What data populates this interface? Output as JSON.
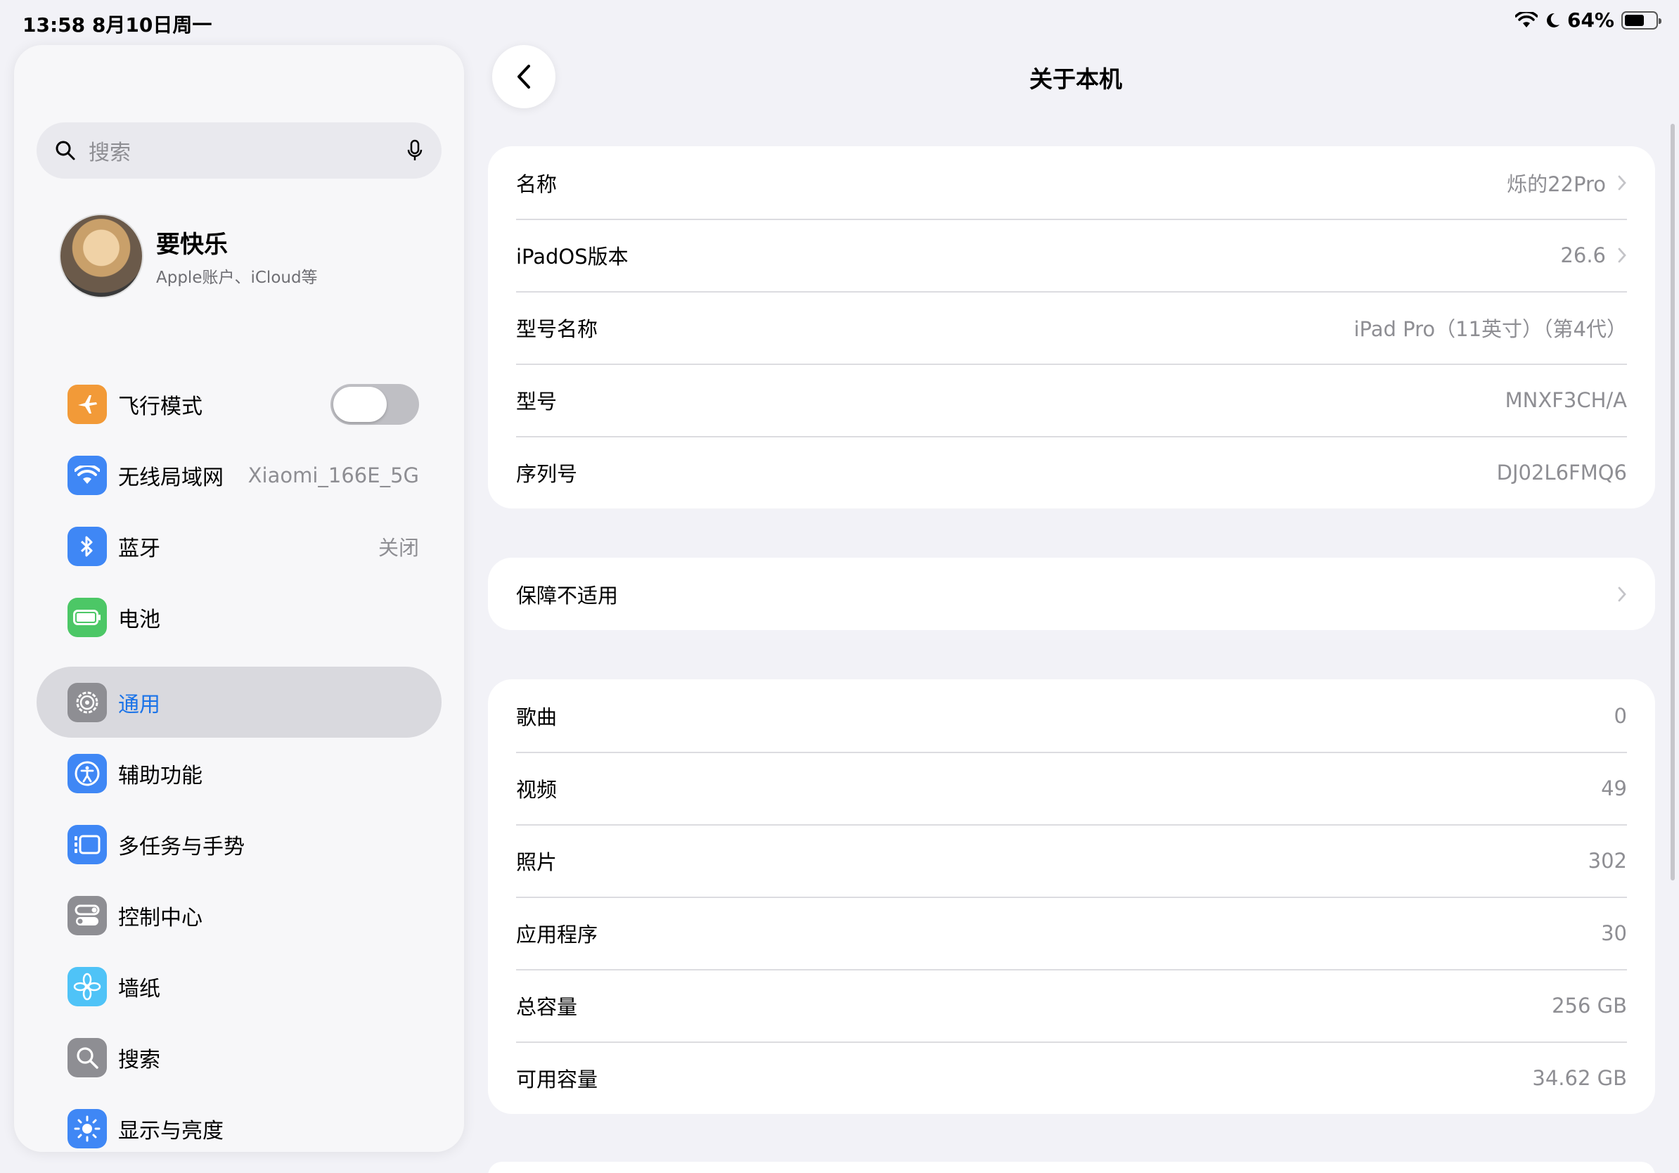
{
  "status_bar": {
    "time_date": "13:58  8月10日周一",
    "battery_percent": "64%",
    "battery_level": 0.64
  },
  "sidebar": {
    "search_placeholder": "搜索",
    "profile": {
      "name": "要快乐",
      "subtitle": "Apple账户、iCloud等"
    },
    "items": [
      {
        "label": "飞行模式",
        "icon": "airplane-icon",
        "color": "#f29a38",
        "toggle": false
      },
      {
        "label": "无线局域网",
        "icon": "wifi-icon",
        "color": "#3f87f5",
        "value": "Xiaomi_166E_5G"
      },
      {
        "label": "蓝牙",
        "icon": "bluetooth-icon",
        "color": "#3f87f5",
        "value": "关闭"
      },
      {
        "label": "电池",
        "icon": "battery-icon",
        "color": "#4cc766"
      },
      {
        "label": "通用",
        "icon": "gear-icon",
        "color": "#8e8e93",
        "selected": true
      },
      {
        "label": "辅助功能",
        "icon": "accessibility-icon",
        "color": "#3f87f5"
      },
      {
        "label": "多任务与手势",
        "icon": "multitasking-icon",
        "color": "#3f87f5"
      },
      {
        "label": "控制中心",
        "icon": "control-center-icon",
        "color": "#8e8e93"
      },
      {
        "label": "墙纸",
        "icon": "wallpaper-icon",
        "color": "#4fc3f7"
      },
      {
        "label": "搜索",
        "icon": "search-icon",
        "color": "#8e8e93"
      },
      {
        "label": "显示与亮度",
        "icon": "brightness-icon",
        "color": "#3f87f5"
      }
    ]
  },
  "main": {
    "title": "关于本机",
    "group1": [
      {
        "label": "名称",
        "value": "烁的22Pro",
        "chevron": true
      },
      {
        "label": "iPadOS版本",
        "value": "26.6",
        "chevron": true
      },
      {
        "label": "型号名称",
        "value": "iPad Pro（11英寸）（第4代）"
      },
      {
        "label": "型号",
        "value": "MNXF3CH/A"
      },
      {
        "label": "序列号",
        "value": "DJ02L6FMQ6"
      }
    ],
    "group2": [
      {
        "label": "保障不适用",
        "chevron": true
      }
    ],
    "group3": [
      {
        "label": "歌曲",
        "value": "0"
      },
      {
        "label": "视频",
        "value": "49"
      },
      {
        "label": "照片",
        "value": "302"
      },
      {
        "label": "应用程序",
        "value": "30"
      },
      {
        "label": "总容量",
        "value": "256 GB"
      },
      {
        "label": "可用容量",
        "value": "34.62 GB"
      }
    ]
  }
}
